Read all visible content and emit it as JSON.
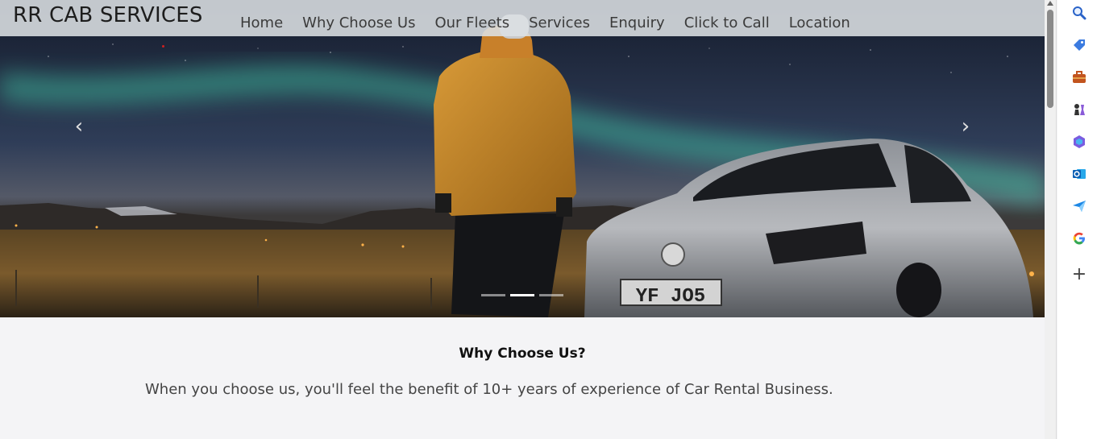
{
  "brand": "RR CAB SERVICES",
  "nav": {
    "items": [
      "Home",
      "Why Choose Us",
      "Our Fleets",
      "Services",
      "Enquiry",
      "Click to Call",
      "Location"
    ]
  },
  "hero": {
    "plate": "YF JO5",
    "prev_glyph": "‹",
    "next_glyph": "›",
    "slides": 3,
    "active_slide": 2
  },
  "why": {
    "title": "Why Choose Us?",
    "text": "When you choose us, you'll feel the benefit of 10+ years of experience of Car Rental Business."
  },
  "sidebar": {
    "icons": [
      "search-icon",
      "tag-icon",
      "briefcase-icon",
      "chess-icon",
      "copilot-icon",
      "outlook-icon",
      "send-icon",
      "google-icon",
      "add-icon"
    ],
    "add_glyph": "+"
  }
}
